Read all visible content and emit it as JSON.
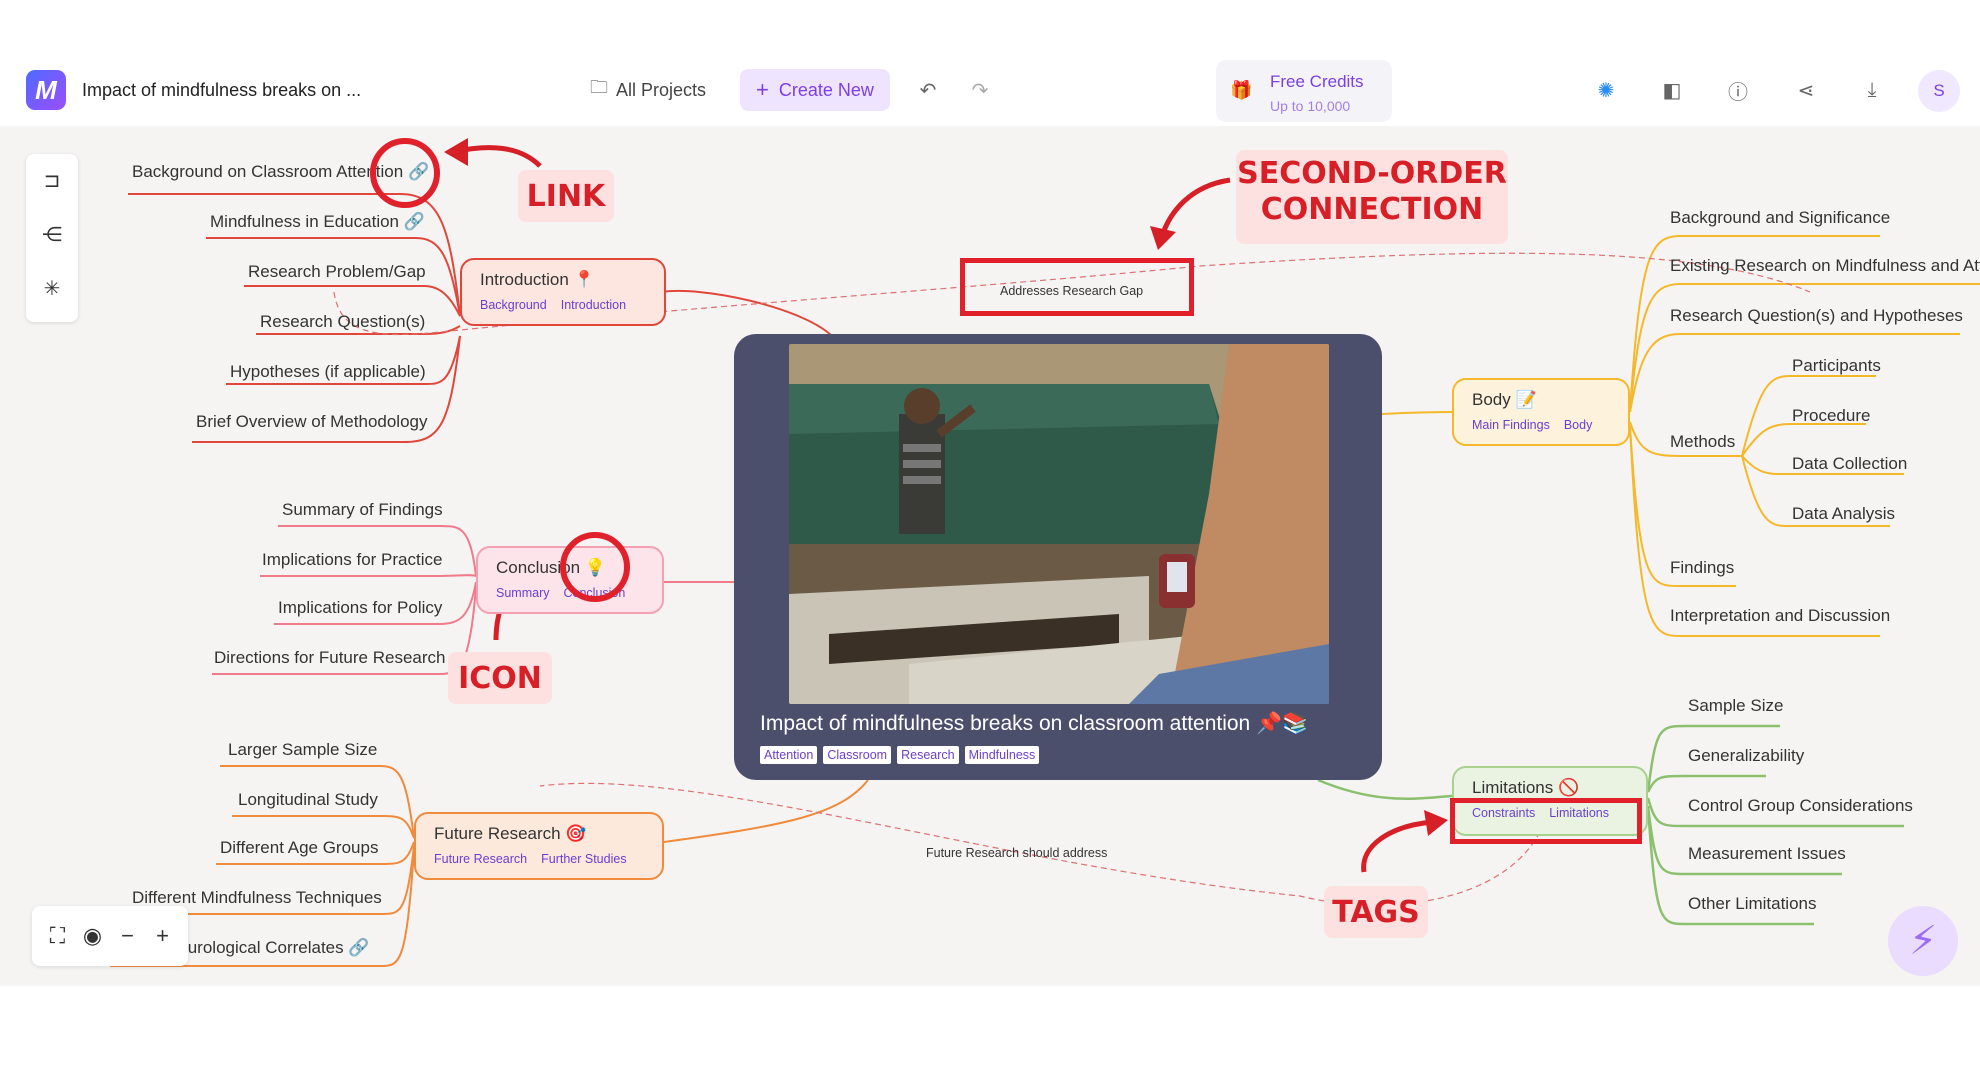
{
  "header": {
    "doc_title": "Impact of mindfulness breaks on ...",
    "all_projects": "All Projects",
    "create_new": "Create New",
    "credits_title": "Free Credits",
    "credits_sub": "Up to 10,000",
    "avatar_initial": "S"
  },
  "central": {
    "title": "Impact of mindfulness breaks on classroom attention",
    "emojis": "📌📚",
    "tags": [
      "Attention",
      "Classroom",
      "Research",
      "Mindfulness"
    ]
  },
  "introduction": {
    "label": "Introduction",
    "icon": "📍",
    "tags": [
      "Background",
      "Introduction"
    ],
    "children": [
      "Background on Classroom Attention",
      "Mindfulness in Education",
      "Research Problem/Gap",
      "Research Question(s)",
      "Hypotheses (if applicable)",
      "Brief Overview of Methodology"
    ]
  },
  "conclusion": {
    "label": "Conclusion",
    "icon": "💡",
    "tags": [
      "Summary",
      "Conclusion"
    ],
    "children": [
      "Summary of Findings",
      "Implications for Practice",
      "Implications for Policy",
      "Directions for Future Research"
    ]
  },
  "future_research": {
    "label": "Future Research",
    "icon": "🎯",
    "tags": [
      "Future Research",
      "Further Studies"
    ],
    "children": [
      "Larger Sample Size",
      "Longitudinal Study",
      "Different Age Groups",
      "Different Mindfulness Techniques",
      "Neurological Correlates"
    ]
  },
  "body": {
    "label": "Body",
    "icon": "📝",
    "tags": [
      "Main Findings",
      "Body"
    ],
    "children": [
      "Background and Significance",
      "Existing Research on Mindfulness and Atte",
      "Research Question(s) and Hypotheses",
      "Methods",
      "Findings",
      "Interpretation and Discussion"
    ],
    "methods_children": [
      "Participants",
      "Procedure",
      "Data Collection",
      "Data Analysis"
    ]
  },
  "limitations": {
    "label": "Limitations",
    "icon": "🚫",
    "tags": [
      "Constraints",
      "Limitations"
    ],
    "children": [
      "Sample Size",
      "Generalizability",
      "Control Group Considerations",
      "Measurement Issues",
      "Other Limitations"
    ]
  },
  "connections": {
    "gap": "Addresses Research Gap",
    "future": "Future Research should address"
  },
  "annotations": {
    "link": "LINK",
    "second_order": "SECOND-ORDER\nCONNECTION",
    "icon": "ICON",
    "tags": "TAGS"
  },
  "colors": {
    "intro": "#e0473a",
    "conclusion": "#f07a8a",
    "future": "#f08a3c",
    "body": "#f5b82a",
    "limitations": "#8cbf6e",
    "annotation": "#e0202a"
  }
}
